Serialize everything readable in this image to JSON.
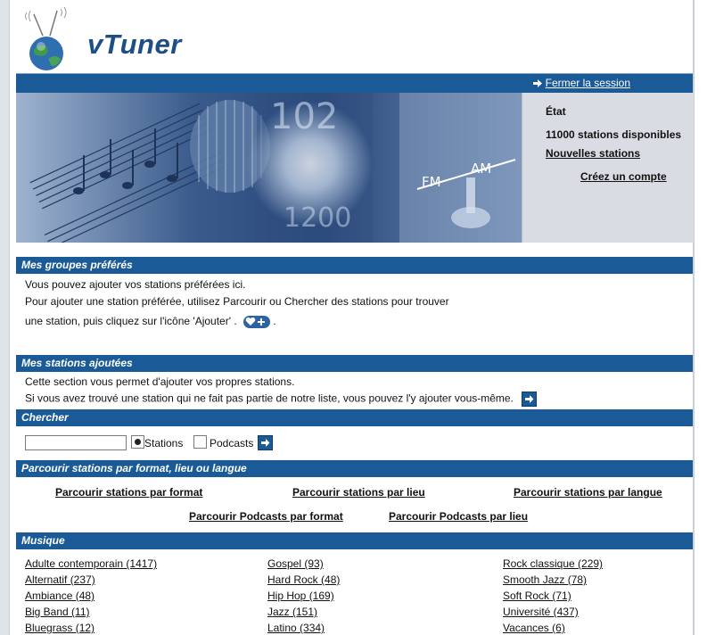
{
  "logo": {
    "text": "vTuner"
  },
  "topbar": {
    "logout_label": "Fermer la session"
  },
  "status": {
    "title": "État",
    "count": "11000  stations disponibles",
    "new_stations": "Nouvelles stations",
    "create_account": "Créez un compte"
  },
  "favorites": {
    "header": "Mes groupes préférés",
    "line1": "Vous pouvez ajouter vos stations préférées ici.",
    "line2": "Pour ajouter une station préférée, utilisez Parcourir ou Chercher des stations pour trouver",
    "line3": "une station, puis cliquez sur l'icône 'Ajouter' .",
    "line3_end": "."
  },
  "added": {
    "header": "Mes stations ajoutées",
    "line1": "Cette section vous permet d'ajouter vos propres stations.",
    "line2": "Si vous avez trouvé une station qui ne fait pas partie de notre liste, vous pouvez l'y ajouter vous-même."
  },
  "search": {
    "header": "Chercher",
    "value": "",
    "options": [
      "Stations",
      "Podcasts"
    ],
    "selected": "Stations"
  },
  "browse": {
    "header": "Parcourir stations par format, lieu ou langue",
    "links_row1": [
      "Parcourir stations par format",
      "Parcourir stations par lieu",
      "Parcourir stations par langue"
    ],
    "links_row2": [
      "Parcourir Podcasts par format",
      "Parcourir Podcasts par lieu"
    ]
  },
  "music": {
    "header": "Musique",
    "col1": [
      "Adulte contemporain (1417)",
      "Alternatif (237)",
      "Ambiance (48)",
      "Big Band (11)",
      "Bluegrass (12)"
    ],
    "col2": [
      "Gospel (93)",
      "Hard Rock (48)",
      "Hip Hop (169)",
      "Jazz (151)",
      "Latino (334)"
    ],
    "col3": [
      "Rock classique (229)",
      "Smooth Jazz (78)",
      "Soft Rock (71)",
      "Université (437)",
      "Vacances (6)"
    ]
  },
  "colors": {
    "bar_blue": "#1a5a96",
    "panel_gray": "#d9dde3"
  },
  "icons": {
    "logo": "globe-antenna-icon",
    "arrow": "arrow-right-icon",
    "heart": "heart-plus-icon"
  }
}
